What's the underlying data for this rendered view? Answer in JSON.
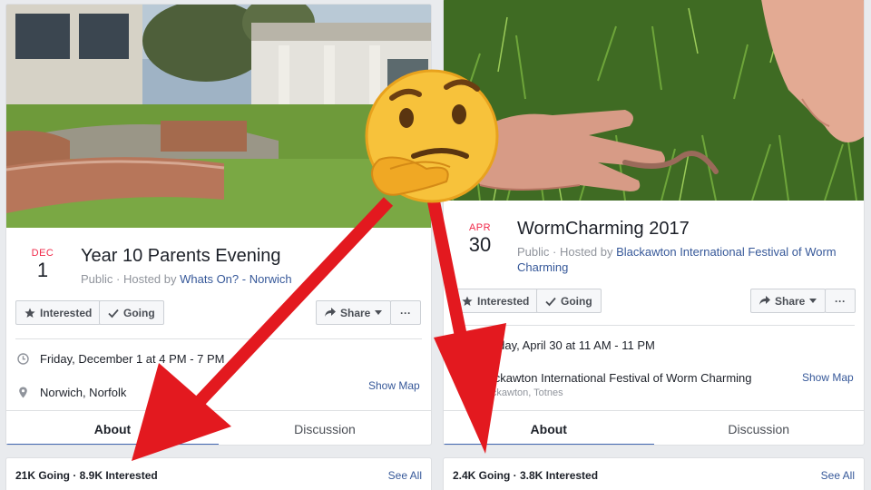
{
  "events": [
    {
      "month": "DEC",
      "day": "1",
      "title": "Year 10 Parents Evening",
      "host_prefix": "Public · Hosted by ",
      "host_link": "Whats On? - Norwich",
      "interested_label": "Interested",
      "going_label": "Going",
      "share_label": "Share",
      "more_label": "···",
      "when": "Friday, December 1 at 4 PM - 7 PM",
      "where": "Norwich, Norfolk",
      "where_sub": "",
      "show_map": "Show Map",
      "tabs": [
        "About",
        "Discussion"
      ],
      "stats": "21K Going · 8.9K Interested",
      "see_all": "See All"
    },
    {
      "month": "APR",
      "day": "30",
      "title": "WormCharming 2017",
      "host_prefix": "Public · Hosted by ",
      "host_link": "Blackawton International Festival of Worm Charming",
      "interested_label": "Interested",
      "going_label": "Going",
      "share_label": "Share",
      "more_label": "···",
      "when": "Sunday, April 30 at 11 AM - 11 PM",
      "where": "Blackawton International Festival of Worm Charming",
      "where_sub": "Blackawton, Totnes",
      "show_map": "Show Map",
      "tabs": [
        "About",
        "Discussion"
      ],
      "stats": "2.4K Going · 3.8K Interested",
      "see_all": "See All"
    }
  ],
  "overlay": {
    "emoji": "thinking-face",
    "arrow_color": "#e3191f"
  }
}
